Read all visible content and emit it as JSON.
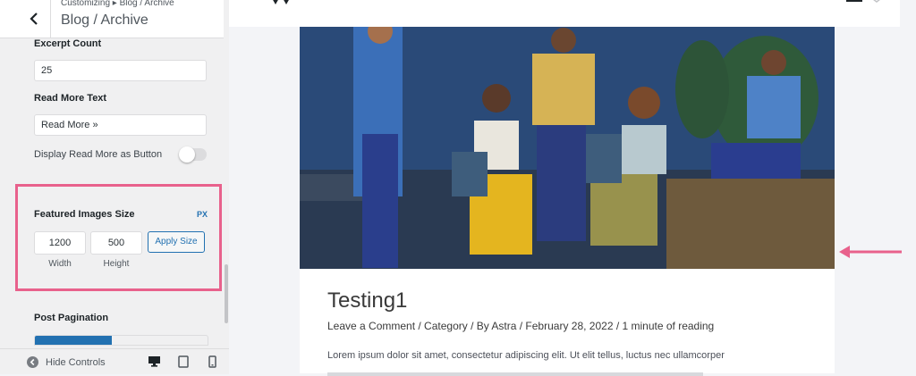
{
  "header": {
    "breadcrumb": "Customizing ▸ Blog / Archive",
    "title": "Blog / Archive"
  },
  "fields": {
    "excerpt_count_label": "Excerpt Count",
    "excerpt_count_value": "25",
    "read_more_label": "Read More Text",
    "read_more_value": "Read More »",
    "read_more_button_label": "Display Read More as Button",
    "read_more_button_on": false
  },
  "featured_images": {
    "label": "Featured Images Size",
    "unit": "PX",
    "width_value": "1200",
    "height_value": "500",
    "width_caption": "Width",
    "height_caption": "Height",
    "apply_label": "Apply Size"
  },
  "pagination": {
    "label": "Post Pagination"
  },
  "footer": {
    "hide_controls": "Hide Controls"
  },
  "post": {
    "title": "Testing1",
    "meta": "Leave a Comment / Category / By Astra / February 28, 2022 / 1 minute of reading",
    "excerpt": "Lorem ipsum dolor sit amet, consectetur adipiscing elit. Ut elit tellus, luctus nec ullamcorper"
  },
  "colors": {
    "accent": "#2271b1",
    "highlight": "#e8618c"
  },
  "icons": [
    "back-arrow-icon",
    "hide-controls-icon",
    "desktop-icon",
    "tablet-icon",
    "mobile-icon",
    "arrow-left-icon"
  ]
}
